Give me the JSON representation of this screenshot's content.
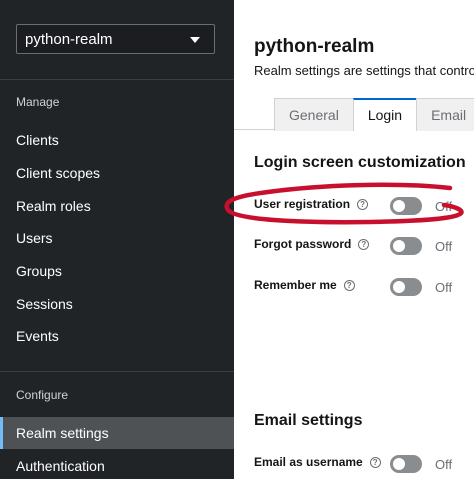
{
  "sidebar": {
    "realm_selector": {
      "value": "python-realm"
    },
    "manage_heading": "Manage",
    "manage_items": [
      "Clients",
      "Client scopes",
      "Realm roles",
      "Users",
      "Groups",
      "Sessions",
      "Events"
    ],
    "configure_heading": "Configure",
    "configure_items": [
      "Realm settings",
      "Authentication"
    ],
    "active_item": "Realm settings"
  },
  "header": {
    "title": "python-realm",
    "subtitle": "Realm settings are settings that contro"
  },
  "tabs": [
    {
      "label": "General",
      "active": false
    },
    {
      "label": "Login",
      "active": true
    },
    {
      "label": "Email",
      "active": false
    }
  ],
  "login_section": {
    "title": "Login screen customization",
    "rows": [
      {
        "label": "User registration",
        "state": "Off",
        "enabled": false
      },
      {
        "label": "Forgot password",
        "state": "Off",
        "enabled": false
      },
      {
        "label": "Remember me",
        "state": "Off",
        "enabled": false
      }
    ]
  },
  "email_section": {
    "title": "Email settings",
    "rows": [
      {
        "label": "Email as username",
        "state": "Off",
        "enabled": false
      }
    ]
  },
  "colors": {
    "sidebar_bg": "#212427",
    "active_item_bg": "#4f5255",
    "active_indicator": "#73bcf7",
    "tab_active_border": "#0066cc",
    "switch_off": "#8a8d90",
    "annotation": "#c8102e"
  },
  "icons": {
    "help": "question-circle-icon",
    "dropdown": "caret-down-icon"
  }
}
